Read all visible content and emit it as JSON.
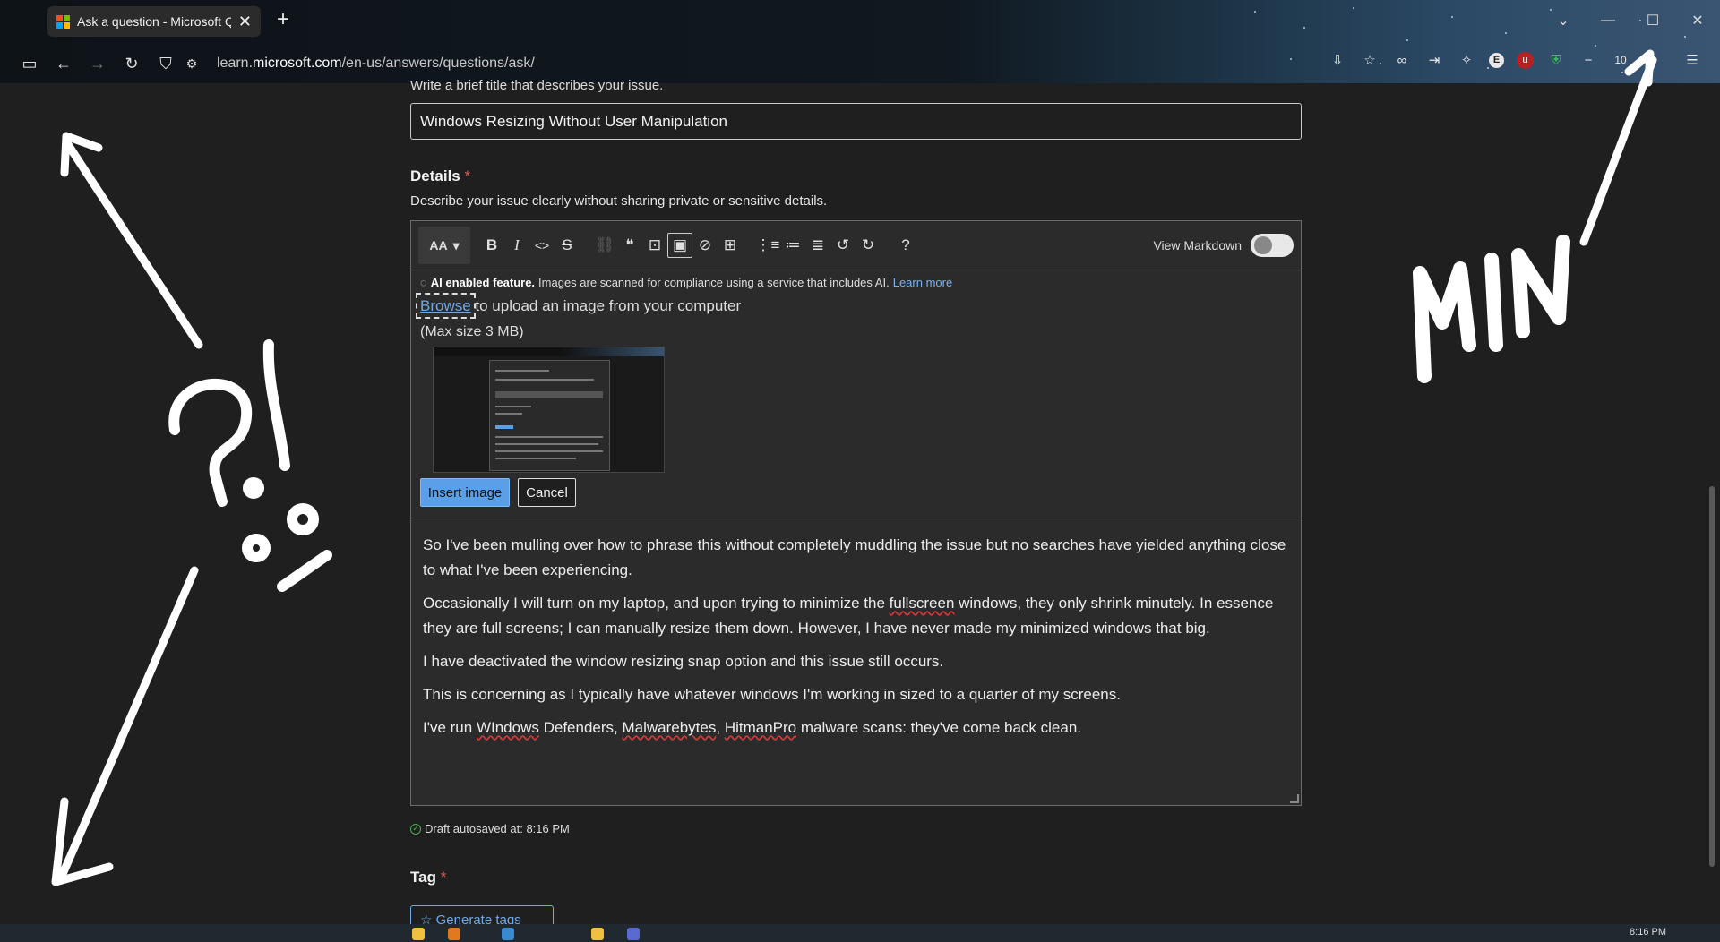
{
  "browser": {
    "tab_title": "Ask a question - Microsoft Q&A",
    "url_prefix": "learn.",
    "url_domain": "microsoft.com",
    "url_path": "/en-us/answers/questions/ask/",
    "zoom": "10"
  },
  "form": {
    "title_hint": "Write a brief title that describes your issue.",
    "title_value": "Windows Resizing Without User Manipulation",
    "details_label": "Details",
    "required_mark": "*",
    "details_desc": "Describe your issue clearly without sharing private or sensitive details.",
    "tag_label": "Tag",
    "generate_tags": "Generate tags"
  },
  "editor": {
    "format_label": "AA",
    "view_markdown": "View Markdown",
    "ai_label": "AI enabled feature.",
    "ai_text": "Images are scanned for compliance using a service that includes AI.",
    "learn_more": "Learn more",
    "browse": "Browse",
    "upload_text": " to upload an image from your computer",
    "max_size": "(Max size 3 MB)",
    "insert_image": "Insert image",
    "cancel": "Cancel"
  },
  "body": {
    "p1": "So I've been mulling over how to phrase this without completely muddling the issue but no searches have yielded anything close to what I've been experiencing.",
    "p2a": "Occasionally I will turn on my laptop, and upon trying to minimize the ",
    "p2b": "fullscreen",
    "p2c": " windows, they only shrink minutely. In essence they are full screens; I can manually resize them down. However, I have never made my minimized windows that big.",
    "p3": "I have deactivated the window resizing snap option and this issue still occurs.",
    "p4": "This is concerning as I typically have whatever windows I'm working in sized to a quarter of my screens.",
    "p5a": "I've run ",
    "p5b": "WIndows",
    "p5c": " Defenders, ",
    "p5d": "Malwarebytes",
    "p5e": ", ",
    "p5f": "HitmanPro",
    "p5g": " malware scans: they've come back clean."
  },
  "autosave": "Draft autosaved at: 8:16 PM",
  "taskbar_clock": "8:16 PM",
  "annotations": {
    "min_text": "MIN",
    "question_marks": "?!",
    "percent": "%"
  },
  "colors": {
    "accent_link": "#6fa8e8",
    "insert_button": "#5aa0e8",
    "required": "#e05a5a"
  }
}
